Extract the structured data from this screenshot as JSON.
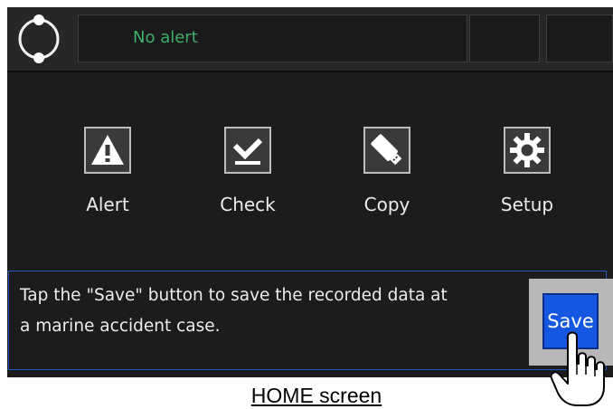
{
  "header": {
    "alert_status": "No alert",
    "alert_color": "#3fae66",
    "status_icon": "status-ring-icon"
  },
  "menu": [
    {
      "label": "Alert",
      "icon": "warning-triangle-icon"
    },
    {
      "label": "Check",
      "icon": "checkmark-icon"
    },
    {
      "label": "Copy",
      "icon": "usb-stick-icon"
    },
    {
      "label": "Setup",
      "icon": "gear-icon"
    }
  ],
  "message": {
    "line1": "Tap the \"Save\" button to save the recorded data at",
    "line2": "a marine accident case."
  },
  "save_button": {
    "label": "Save",
    "color": "#1557e0"
  },
  "pointer_icon": "pointing-hand-icon",
  "caption": "HOME screen"
}
